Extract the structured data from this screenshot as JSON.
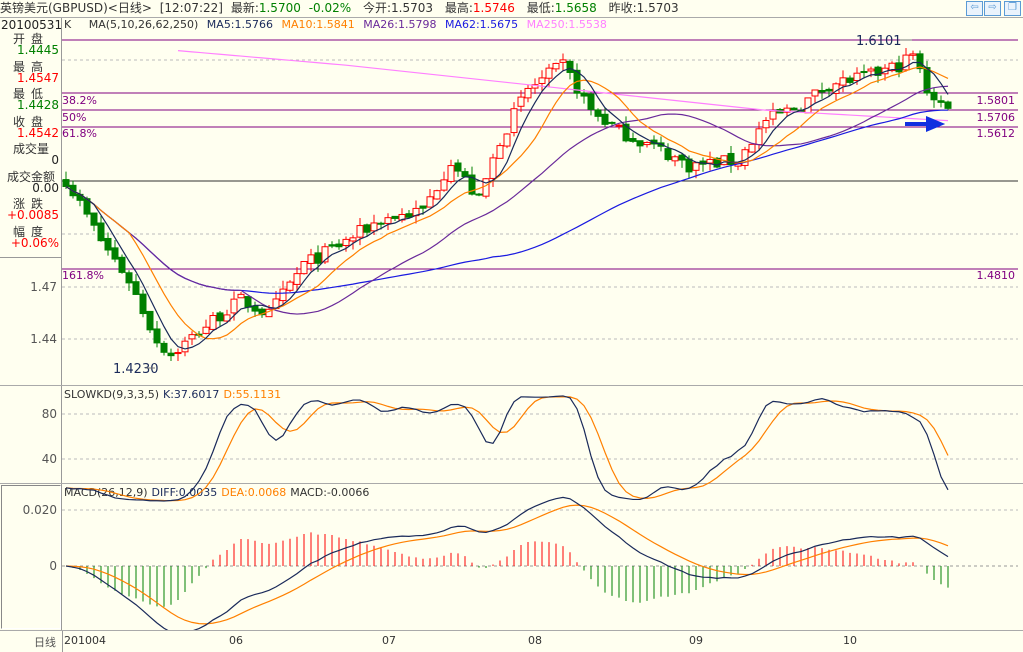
{
  "header": {
    "title": "英镑美元(GBPUSD)<日线>",
    "time": "[12:07:22]",
    "latest_label": "最新:",
    "latest": "1.5700",
    "change_pct": "-0.02%",
    "open_label": "今开:",
    "open": "1.5703",
    "high_label": "最高:",
    "high": "1.5746",
    "low_label": "最低:",
    "low": "1.5658",
    "prev_label": "昨收:",
    "prev": "1.5703"
  },
  "window_buttons": {
    "back": "⇦",
    "forward": "⇨",
    "restore": "❐"
  },
  "info": {
    "date": "20100531",
    "k": "K",
    "ma_params": "MA(5,10,26,62,250)",
    "ma5": "MA5:1.5766",
    "ma10": "MA10:1.5841",
    "ma26": "MA26:1.5798",
    "ma62": "MA62:1.5675",
    "ma250": "MA250:1.5538"
  },
  "left_panel": [
    {
      "label": "开盘",
      "value": "1.4445",
      "color": "#008000"
    },
    {
      "label": "最高",
      "value": "1.4547",
      "color": "#ff0000"
    },
    {
      "label": "最低",
      "value": "1.4428",
      "color": "#008000"
    },
    {
      "label": "收盘",
      "value": "1.4542",
      "color": "#ff0000"
    },
    {
      "label": "成交量",
      "value": "0",
      "color": "#222222"
    },
    {
      "label": "成交金额",
      "value": "0.00",
      "color": "#222222"
    },
    {
      "label": "涨跌",
      "value": "+0.0085",
      "color": "#ff0000"
    },
    {
      "label": "幅度",
      "value": "+0.06%",
      "color": "#ff0000"
    }
  ],
  "price_axis": [
    "1.47",
    "1.44"
  ],
  "fib": {
    "l382": "38.2%",
    "l50": "50%",
    "l618": "61.8%",
    "l1618": "161.8%",
    "v382": "1.5801",
    "v50": "1.5706",
    "v618": "1.5612",
    "v1618": "1.4810"
  },
  "annotations": {
    "high": "1.6101",
    "low": "1.4230"
  },
  "kd": {
    "title": "SLOWKD(9,3,3,5)",
    "k": "K:37.6017",
    "d": "D:55.1131",
    "axis": [
      "80",
      "40"
    ]
  },
  "macd": {
    "title": "MACD(26,12,9)",
    "diff": "DIFF:0.0035",
    "dea": "DEA:0.0068",
    "macd": "MACD:-0.0066",
    "axis": [
      "0.020",
      "0"
    ]
  },
  "xaxis": {
    "label": "日线",
    "ticks": [
      "201004",
      "06",
      "07",
      "08",
      "09",
      "10"
    ]
  },
  "chart_data": {
    "type": "candlestick",
    "num_candles": 127,
    "close_keypoints": [
      [
        0,
        1.532
      ],
      [
        5,
        1.497
      ],
      [
        9,
        1.474
      ],
      [
        13,
        1.439
      ],
      [
        15,
        1.431
      ],
      [
        21,
        1.451
      ],
      [
        25,
        1.4625
      ],
      [
        29,
        1.454
      ],
      [
        34,
        1.483
      ],
      [
        39,
        1.494
      ],
      [
        45,
        1.509
      ],
      [
        51,
        1.514
      ],
      [
        55,
        1.543
      ],
      [
        59,
        1.52
      ],
      [
        62,
        1.555
      ],
      [
        66,
        1.584
      ],
      [
        71,
        1.598
      ],
      [
        75,
        1.572
      ],
      [
        79,
        1.56
      ],
      [
        85,
        1.549
      ],
      [
        89,
        1.54
      ],
      [
        96,
        1.543
      ],
      [
        100,
        1.566
      ],
      [
        105,
        1.575
      ],
      [
        109,
        1.587
      ],
      [
        115,
        1.592
      ],
      [
        119,
        1.598
      ],
      [
        121,
        1.604
      ],
      [
        123,
        1.584
      ],
      [
        126,
        1.572
      ]
    ],
    "ma250_keypoints": [
      [
        0,
        1.612
      ],
      [
        40,
        1.598
      ],
      [
        70,
        1.585
      ],
      [
        100,
        1.572
      ],
      [
        126,
        1.566
      ]
    ],
    "colors": {
      "up": "#ff0000",
      "down": "#008000",
      "ma5": "#1a2a5a",
      "ma10": "#ff8000",
      "ma26": "#6a2a9a",
      "ma62": "#1a1ae0",
      "ma250": "#ff80ff",
      "diff": "#1a2a5a",
      "dea": "#ff8000"
    }
  }
}
